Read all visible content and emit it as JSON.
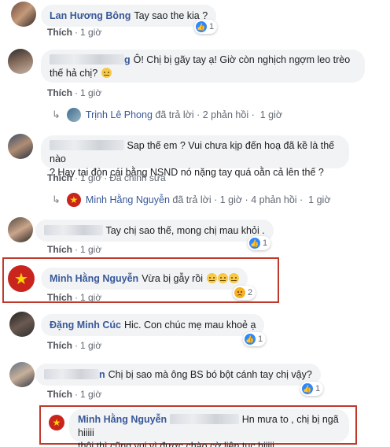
{
  "comments": [
    {
      "name": "Lan Hương Bông",
      "text": "Tay sao the kia ?",
      "like": "Thích",
      "time": "1 giờ",
      "reactions": "1"
    },
    {
      "name_tail": "g",
      "text_line1": "Ô! Chị bị gãy tay ạ! Giờ còn nghịch ngợm leo trèo",
      "text_line2": "thế hả chị?",
      "like": "Thích",
      "time": "1 giờ",
      "reply": {
        "name": "Trịnh Lê Phong",
        "action": "đã trả lời",
        "count": "2 phản hồi",
        "time": "1 giờ"
      }
    },
    {
      "text_line1": "Sap thế em ? Vui chưa kịp đến hoạ đã kề là thế nào",
      "text_line2": "? Hay tại đòn cái bằng NSND nó nặng tay quá oằn cả lên thế ?",
      "like": "Thích",
      "time": "1 giờ",
      "edited": "Đã chỉnh sửa",
      "reply": {
        "name": "Minh Hằng Nguyễn",
        "action": "đã trả lời",
        "count": "4 phản hồi",
        "time": "1 giờ"
      }
    },
    {
      "text": "Tay chị sao thế, mong chị mau khỏi .",
      "like": "Thích",
      "time": "1 giờ",
      "reactions": "1"
    },
    {
      "name": "Minh Hằng Nguyễn",
      "text": "Vừa bị gẫy rồi",
      "like": "Thích",
      "time": "1 giờ",
      "reactions": "2"
    },
    {
      "name": "Đặng Minh Cúc",
      "text": "Hic. Con chúc mẹ mau khoẻ ạ",
      "like": "Thích",
      "time": "1 giờ",
      "reactions": "1"
    },
    {
      "name_tail": "n",
      "text": "Chị bị sao mà ông BS bó bột cánh tay chị vậy?",
      "like": "Thích",
      "time": "1 giờ",
      "reactions": "1"
    },
    {
      "name": "Minh Hằng Nguyễn",
      "text_line1": "Hn mưa to , chị bị ngã hiiiii",
      "text_line2": "thôi thì cũng vui vì được chào cờ liên tục hiiiii"
    }
  ],
  "colors": {
    "name": "#385898",
    "bubble": "#f2f3f5",
    "highlight": "#c0392b",
    "like": "#2d88ff"
  }
}
